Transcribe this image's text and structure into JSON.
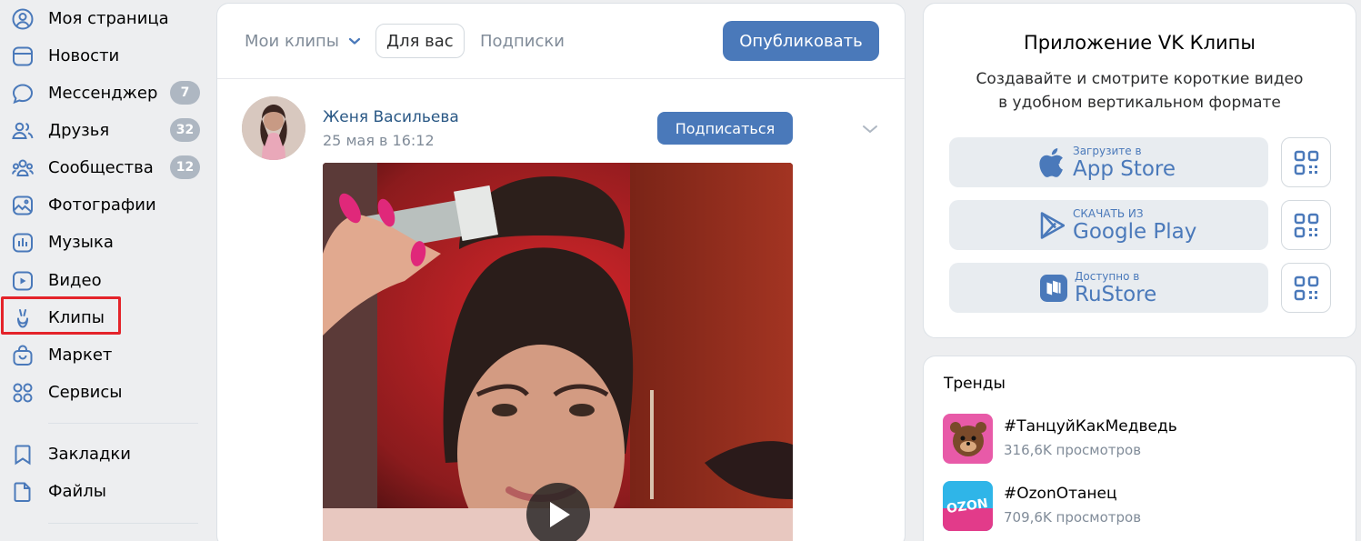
{
  "sidebar": {
    "items": [
      {
        "label": "Моя страница",
        "icon": "user-circle-icon"
      },
      {
        "label": "Новости",
        "icon": "newspaper-icon"
      },
      {
        "label": "Мессенджер",
        "icon": "message-icon",
        "badge": "7"
      },
      {
        "label": "Друзья",
        "icon": "friends-icon",
        "badge": "32"
      },
      {
        "label": "Сообщества",
        "icon": "communities-icon",
        "badge": "12"
      },
      {
        "label": "Фотографии",
        "icon": "photo-icon"
      },
      {
        "label": "Музыка",
        "icon": "music-icon"
      },
      {
        "label": "Видео",
        "icon": "video-icon"
      },
      {
        "label": "Клипы",
        "icon": "clips-icon"
      },
      {
        "label": "Маркет",
        "icon": "market-bag-icon"
      },
      {
        "label": "Сервисы",
        "icon": "services-grid-icon"
      },
      {
        "label": "Закладки",
        "icon": "bookmark-icon"
      },
      {
        "label": "Файлы",
        "icon": "file-icon"
      }
    ]
  },
  "clips": {
    "tabs": {
      "mine": "Мои клипы",
      "for_you": "Для вас",
      "subscriptions": "Подписки"
    },
    "publish_label": "Опубликовать"
  },
  "post": {
    "author": "Женя Васильева",
    "date": "25 мая в 16:12",
    "subscribe_label": "Подписаться"
  },
  "promo": {
    "title": "Приложение VK Клипы",
    "text_line1": "Создавайте и смотрите короткие видео",
    "text_line2": "в удобном вертикальном формате",
    "stores": [
      {
        "small": "Загрузите в",
        "big": "App Store",
        "icon": "apple-icon"
      },
      {
        "small": "СКАЧАТЬ ИЗ",
        "big": "Google Play",
        "icon": "google-play-icon"
      },
      {
        "small": "Доступно в",
        "big": "RuStore",
        "icon": "rustore-icon"
      }
    ]
  },
  "trends": {
    "title": "Тренды",
    "items": [
      {
        "name": "#ТанцуйКакМедведь",
        "views": "316,6K просмотров"
      },
      {
        "name": "#OzonOтанец",
        "views": "709,6K просмотров",
        "thumb_text": "OZON"
      }
    ]
  },
  "colors": {
    "accent": "#4a79ba",
    "link": "#2a5885",
    "highlight": "#e4232a",
    "background": "#edeef0"
  }
}
